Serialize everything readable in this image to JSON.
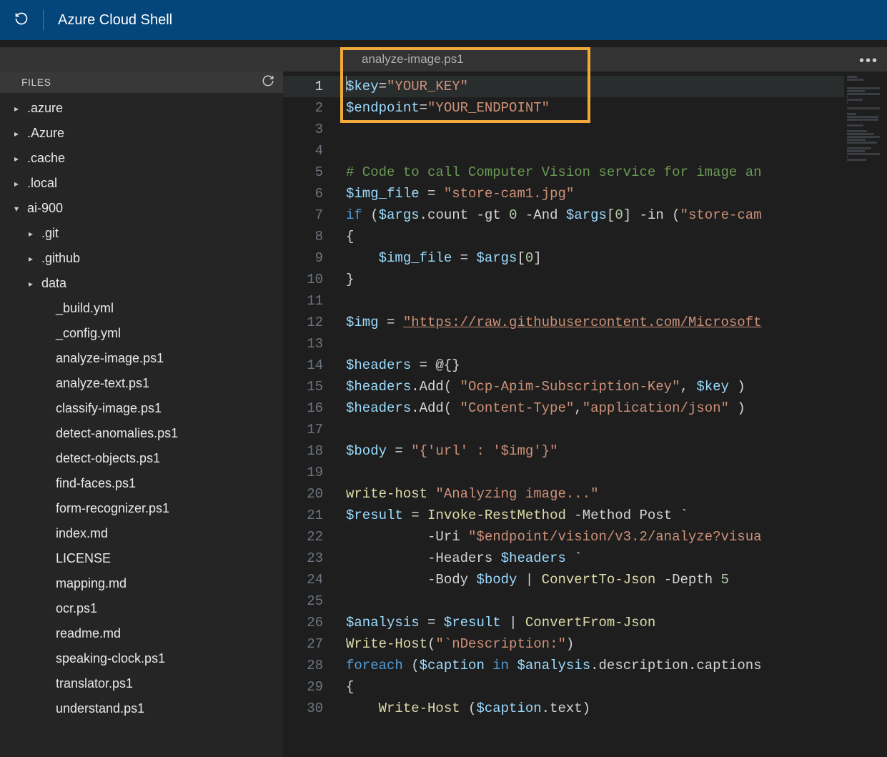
{
  "titlebar": {
    "title": "Azure Cloud Shell"
  },
  "tabbar": {
    "filename": "analyze-image.ps1"
  },
  "sidebar": {
    "header": "FILES",
    "tree": [
      {
        "label": ".azure",
        "depth": 0,
        "expanded": false,
        "leaf": false
      },
      {
        "label": ".Azure",
        "depth": 0,
        "expanded": false,
        "leaf": false
      },
      {
        "label": ".cache",
        "depth": 0,
        "expanded": false,
        "leaf": false
      },
      {
        "label": ".local",
        "depth": 0,
        "expanded": false,
        "leaf": false
      },
      {
        "label": "ai-900",
        "depth": 0,
        "expanded": true,
        "leaf": false
      },
      {
        "label": ".git",
        "depth": 1,
        "expanded": false,
        "leaf": false
      },
      {
        "label": ".github",
        "depth": 1,
        "expanded": false,
        "leaf": false
      },
      {
        "label": "data",
        "depth": 1,
        "expanded": false,
        "leaf": false
      },
      {
        "label": "_build.yml",
        "depth": 2,
        "leaf": true
      },
      {
        "label": "_config.yml",
        "depth": 2,
        "leaf": true
      },
      {
        "label": "analyze-image.ps1",
        "depth": 2,
        "leaf": true
      },
      {
        "label": "analyze-text.ps1",
        "depth": 2,
        "leaf": true
      },
      {
        "label": "classify-image.ps1",
        "depth": 2,
        "leaf": true
      },
      {
        "label": "detect-anomalies.ps1",
        "depth": 2,
        "leaf": true
      },
      {
        "label": "detect-objects.ps1",
        "depth": 2,
        "leaf": true
      },
      {
        "label": "find-faces.ps1",
        "depth": 2,
        "leaf": true
      },
      {
        "label": "form-recognizer.ps1",
        "depth": 2,
        "leaf": true
      },
      {
        "label": "index.md",
        "depth": 2,
        "leaf": true
      },
      {
        "label": "LICENSE",
        "depth": 2,
        "leaf": true
      },
      {
        "label": "mapping.md",
        "depth": 2,
        "leaf": true
      },
      {
        "label": "ocr.ps1",
        "depth": 2,
        "leaf": true
      },
      {
        "label": "readme.md",
        "depth": 2,
        "leaf": true
      },
      {
        "label": "speaking-clock.ps1",
        "depth": 2,
        "leaf": true
      },
      {
        "label": "translator.ps1",
        "depth": 2,
        "leaf": true
      },
      {
        "label": "understand.ps1",
        "depth": 2,
        "leaf": true
      }
    ]
  },
  "editor": {
    "active_line": 1,
    "lines": [
      [
        [
          "var",
          "$key"
        ],
        [
          "op",
          "="
        ],
        [
          "str",
          "\"YOUR_KEY\""
        ]
      ],
      [
        [
          "var",
          "$endpoint"
        ],
        [
          "op",
          "="
        ],
        [
          "str",
          "\"YOUR_ENDPOINT\""
        ]
      ],
      [],
      [],
      [
        [
          "cmt",
          "# Code to call Computer Vision service for image an"
        ]
      ],
      [
        [
          "var",
          "$img_file"
        ],
        [
          "op",
          " = "
        ],
        [
          "str",
          "\"store-cam1.jpg\""
        ]
      ],
      [
        [
          "kw",
          "if"
        ],
        [
          "op",
          " ("
        ],
        [
          "var",
          "$args"
        ],
        [
          "op",
          ".count "
        ],
        [
          "op",
          "-gt "
        ],
        [
          "num",
          "0"
        ],
        [
          "op",
          " "
        ],
        [
          "op",
          "-And "
        ],
        [
          "var",
          "$args"
        ],
        [
          "op",
          "["
        ],
        [
          "num",
          "0"
        ],
        [
          "op",
          "] "
        ],
        [
          "op",
          "-in "
        ],
        [
          "op",
          "("
        ],
        [
          "str",
          "\"store-cam"
        ]
      ],
      [
        [
          "punc",
          "{"
        ]
      ],
      [
        [
          "op",
          "    "
        ],
        [
          "var",
          "$img_file"
        ],
        [
          "op",
          " = "
        ],
        [
          "var",
          "$args"
        ],
        [
          "op",
          "["
        ],
        [
          "num",
          "0"
        ],
        [
          "op",
          "]"
        ]
      ],
      [
        [
          "punc",
          "}"
        ]
      ],
      [],
      [
        [
          "var",
          "$img"
        ],
        [
          "op",
          " = "
        ],
        [
          "url",
          "\"https://raw.githubusercontent.com/Microsoft"
        ]
      ],
      [],
      [
        [
          "var",
          "$headers"
        ],
        [
          "op",
          " = @{}"
        ]
      ],
      [
        [
          "var",
          "$headers"
        ],
        [
          "op",
          ".Add( "
        ],
        [
          "str",
          "\"Ocp-Apim-Subscription-Key\""
        ],
        [
          "op",
          ", "
        ],
        [
          "var",
          "$key"
        ],
        [
          "op",
          " )"
        ]
      ],
      [
        [
          "var",
          "$headers"
        ],
        [
          "op",
          ".Add( "
        ],
        [
          "str",
          "\"Content-Type\""
        ],
        [
          "op",
          ","
        ],
        [
          "str",
          "\"application/json\""
        ],
        [
          "op",
          " )"
        ]
      ],
      [],
      [
        [
          "var",
          "$body"
        ],
        [
          "op",
          " = "
        ],
        [
          "str",
          "\"{'url' : '$img'}\""
        ]
      ],
      [],
      [
        [
          "cmd",
          "write-host"
        ],
        [
          "op",
          " "
        ],
        [
          "str",
          "\"Analyzing image...\""
        ]
      ],
      [
        [
          "var",
          "$result"
        ],
        [
          "op",
          " = "
        ],
        [
          "cmd",
          "Invoke-RestMethod"
        ],
        [
          "op",
          " -Method Post `"
        ]
      ],
      [
        [
          "op",
          "          -Uri "
        ],
        [
          "str",
          "\"$endpoint/vision/v3.2/analyze?visua"
        ]
      ],
      [
        [
          "op",
          "          -Headers "
        ],
        [
          "var",
          "$headers"
        ],
        [
          "op",
          " `"
        ]
      ],
      [
        [
          "op",
          "          -Body "
        ],
        [
          "var",
          "$body"
        ],
        [
          "op",
          " | "
        ],
        [
          "cmd",
          "ConvertTo-Json"
        ],
        [
          "op",
          " -Depth "
        ],
        [
          "num",
          "5"
        ]
      ],
      [],
      [
        [
          "var",
          "$analysis"
        ],
        [
          "op",
          " = "
        ],
        [
          "var",
          "$result"
        ],
        [
          "op",
          " | "
        ],
        [
          "cmd",
          "ConvertFrom-Json"
        ]
      ],
      [
        [
          "cmd",
          "Write-Host"
        ],
        [
          "op",
          "("
        ],
        [
          "str",
          "\"`nDescription:\""
        ],
        [
          "op",
          ")"
        ]
      ],
      [
        [
          "kw",
          "foreach"
        ],
        [
          "op",
          " ("
        ],
        [
          "var",
          "$caption"
        ],
        [
          "op",
          " "
        ],
        [
          "kw",
          "in"
        ],
        [
          "op",
          " "
        ],
        [
          "var",
          "$analysis"
        ],
        [
          "op",
          ".description.captions"
        ]
      ],
      [
        [
          "punc",
          "{"
        ]
      ],
      [
        [
          "op",
          "    "
        ],
        [
          "cmd",
          "Write-Host"
        ],
        [
          "op",
          " ("
        ],
        [
          "var",
          "$caption"
        ],
        [
          "op",
          ".text)"
        ]
      ]
    ]
  }
}
